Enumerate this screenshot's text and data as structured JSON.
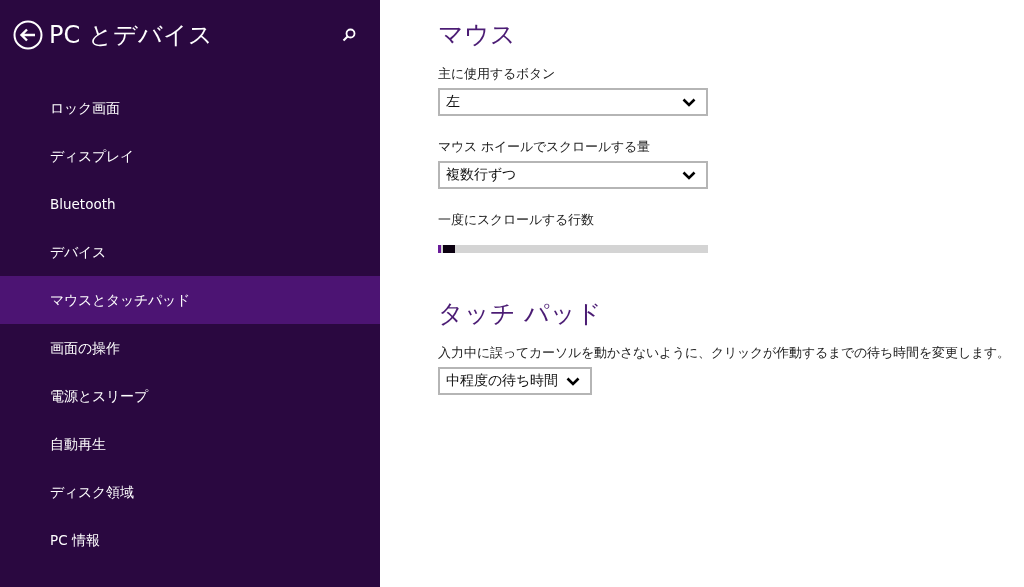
{
  "sidebar": {
    "title": "PC とデバイス",
    "items": [
      {
        "label": "ロック画面",
        "selected": false
      },
      {
        "label": "ディスプレイ",
        "selected": false
      },
      {
        "label": "Bluetooth",
        "selected": false
      },
      {
        "label": "デバイス",
        "selected": false
      },
      {
        "label": "マウスとタッチパッド",
        "selected": true
      },
      {
        "label": "画面の操作",
        "selected": false
      },
      {
        "label": "電源とスリープ",
        "selected": false
      },
      {
        "label": "自動再生",
        "selected": false
      },
      {
        "label": "ディスク領域",
        "selected": false
      },
      {
        "label": "PC 情報",
        "selected": false
      }
    ]
  },
  "sections": [
    {
      "heading": "マウス",
      "controls": [
        {
          "kind": "dropdown",
          "label": "主に使用するボタン",
          "value": "左",
          "wide": true
        },
        {
          "kind": "dropdown",
          "label": "マウス ホイールでスクロールする量",
          "value": "複数行ずつ",
          "wide": true
        },
        {
          "kind": "slider",
          "label": "一度にスクロールする行数",
          "level": 0.01
        }
      ]
    },
    {
      "heading": "タッチ パッド",
      "controls": [
        {
          "kind": "dropdown",
          "label": "入力中に誤ってカーソルを動かさないように、クリックが作動するまでの待ち時間を変更します。",
          "value": "中程度の待ち時間",
          "wide": false
        }
      ]
    }
  ]
}
